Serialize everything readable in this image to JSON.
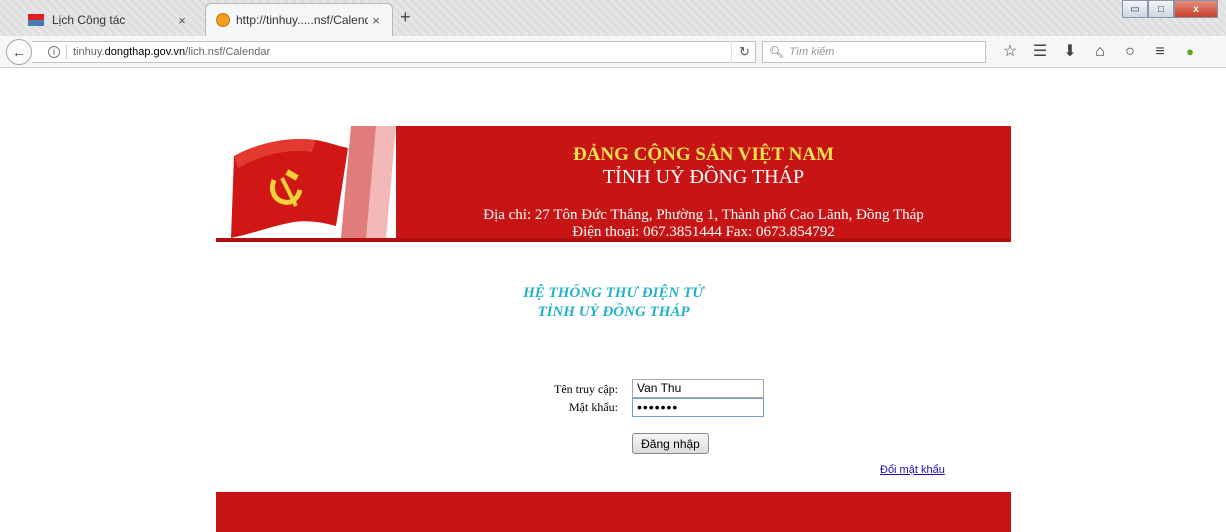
{
  "browser": {
    "tabs": [
      {
        "label": "Lịch Công tác",
        "active": false
      },
      {
        "label": "http://tinhuy.....nsf/Calendar",
        "active": true
      }
    ],
    "new_tab": "+",
    "tab_close": "×",
    "url": {
      "prefix": "tinhuy.",
      "domain": "dongthap.gov.vn",
      "path": "/lich.nsf/Calendar"
    },
    "search_placeholder": "Tìm kiếm",
    "window_controls": {
      "minimize": "▭",
      "maximize": "□",
      "close": "x"
    }
  },
  "banner": {
    "party_name": "ĐẢNG CỘNG SẢN VIỆT NAM",
    "province_name": "TỈNH UỶ ĐỒNG THÁP",
    "address": "Địa chỉ: 27 Tôn Đức Thắng, Phường 1, Thành phố Cao Lãnh, Đồng Tháp",
    "phone": "Điện thoại: 067.3851444 Fax: 0673.854792"
  },
  "system_title": {
    "line1": "HỆ THỐNG THƯ ĐIỆN TỬ",
    "line2": "TỈNH UỶ ĐỒNG THÁP"
  },
  "login": {
    "username_label": "Tên truy cập:",
    "username_value": "Van Thu",
    "password_label": "Mật khẩu:",
    "password_value": "•••••••",
    "submit_label": "Đăng nhập",
    "change_password_link": "Đổi mật khẩu"
  },
  "colors": {
    "banner_red": "#c71414",
    "party_name_yellow": "#f7e24a",
    "system_title_cyan": "#23b2c8",
    "link_blue": "#1a0dab"
  }
}
